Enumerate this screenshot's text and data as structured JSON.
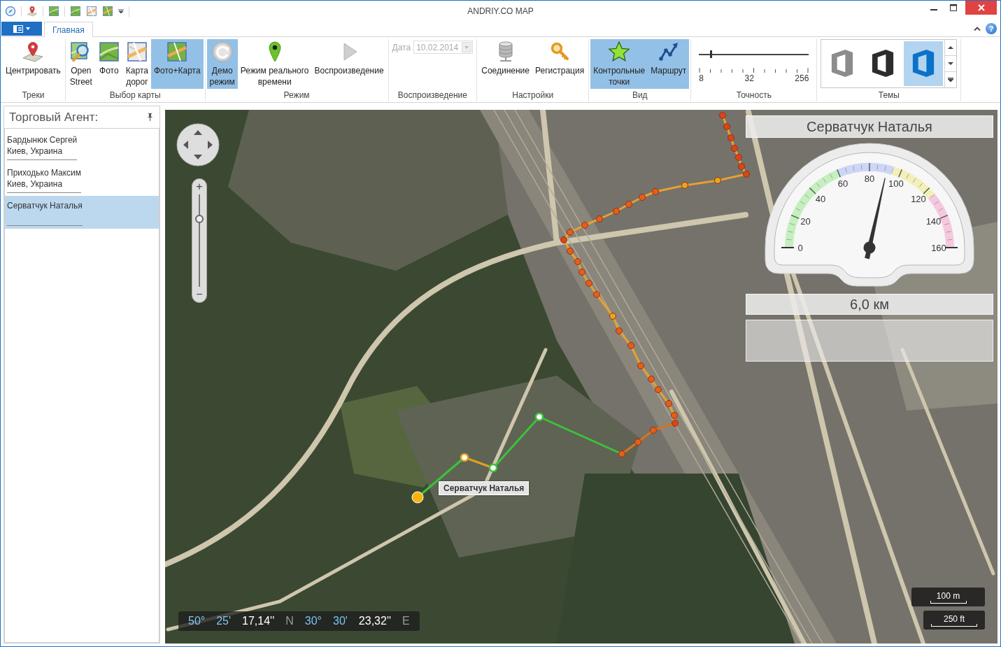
{
  "window": {
    "title": "ANDRIY.CO MAP"
  },
  "ribbon": {
    "tabs": [
      {
        "label": "Главная",
        "selected": true
      }
    ],
    "help": "?",
    "groups": [
      {
        "kind": "buttons",
        "label": "Треки",
        "buttons": [
          {
            "label": "Центрировать",
            "selected": false
          }
        ]
      },
      {
        "kind": "buttons",
        "label": "Выбор карты",
        "buttons": [
          {
            "label": "Open\nStreet",
            "selected": false
          },
          {
            "label": "Фото",
            "selected": false
          },
          {
            "label": "Карта\nдорог",
            "selected": false
          },
          {
            "label": "Фото+Карта",
            "selected": true
          }
        ]
      },
      {
        "kind": "buttons",
        "label": "Режим",
        "buttons": [
          {
            "label": "Демо\nрежим",
            "selected": true
          },
          {
            "label": "Режим реального\nвремени",
            "selected": false
          },
          {
            "label": "Воспроизведение",
            "selected": false
          }
        ]
      },
      {
        "kind": "date",
        "label": "Воспроизведение",
        "field_label": "Дата",
        "value": "10.02.2014",
        "disabled": true
      },
      {
        "kind": "buttons",
        "label": "Настройки",
        "buttons": [
          {
            "label": "Соединение",
            "selected": false
          },
          {
            "label": "Регистрация",
            "selected": false
          }
        ]
      },
      {
        "kind": "buttons",
        "label": "Вид",
        "buttons": [
          {
            "label": "Контрольные\nточки",
            "selected": true
          },
          {
            "label": "Маршрут",
            "selected": true
          }
        ]
      },
      {
        "kind": "slider",
        "label": "Точность",
        "level": 0.1,
        "ticks": [
          "8",
          "32",
          "256"
        ]
      },
      {
        "kind": "gallery",
        "label": "Темы",
        "items": [
          {
            "color": "#8c8c8c",
            "selected": false
          },
          {
            "color": "#2d2d2d",
            "selected": false
          },
          {
            "color": "#0a72c8",
            "selected": true
          }
        ]
      }
    ]
  },
  "agents_panel": {
    "title": "Торговый Агент:",
    "agents": [
      {
        "name": "Бардынюк Сергей",
        "city": "Киев, Украина",
        "selected": false
      },
      {
        "name": "Приходько Максим",
        "city": "Киев, Украина",
        "selected": false
      },
      {
        "name": "Серватчук Наталья",
        "selected": true
      }
    ]
  },
  "map": {
    "marker_label": "Серватчук Наталья",
    "zoom": {
      "plus": "+",
      "minus": "−",
      "level": 0.76
    },
    "info": {
      "title": "Серватчук Наталья",
      "distance": "6,0 км"
    },
    "gauge": {
      "labels": [
        "0",
        "20",
        "40",
        "60",
        "80",
        "100",
        "120",
        "140",
        "160"
      ],
      "level": 0.57
    },
    "coordinates": [
      {
        "text": "50°",
        "kind": "degrees"
      },
      {
        "text": "25'",
        "kind": "minutes"
      },
      {
        "text": "17,14''",
        "kind": "seconds"
      },
      {
        "text": "N",
        "kind": "hemisphere"
      },
      {
        "text": "30°",
        "kind": "degrees"
      },
      {
        "text": "30'",
        "kind": "minutes"
      },
      {
        "text": "23,32''",
        "kind": "seconds"
      },
      {
        "text": "E",
        "kind": "hemisphere"
      }
    ],
    "scale": [
      "100 m",
      "250 ft"
    ]
  }
}
